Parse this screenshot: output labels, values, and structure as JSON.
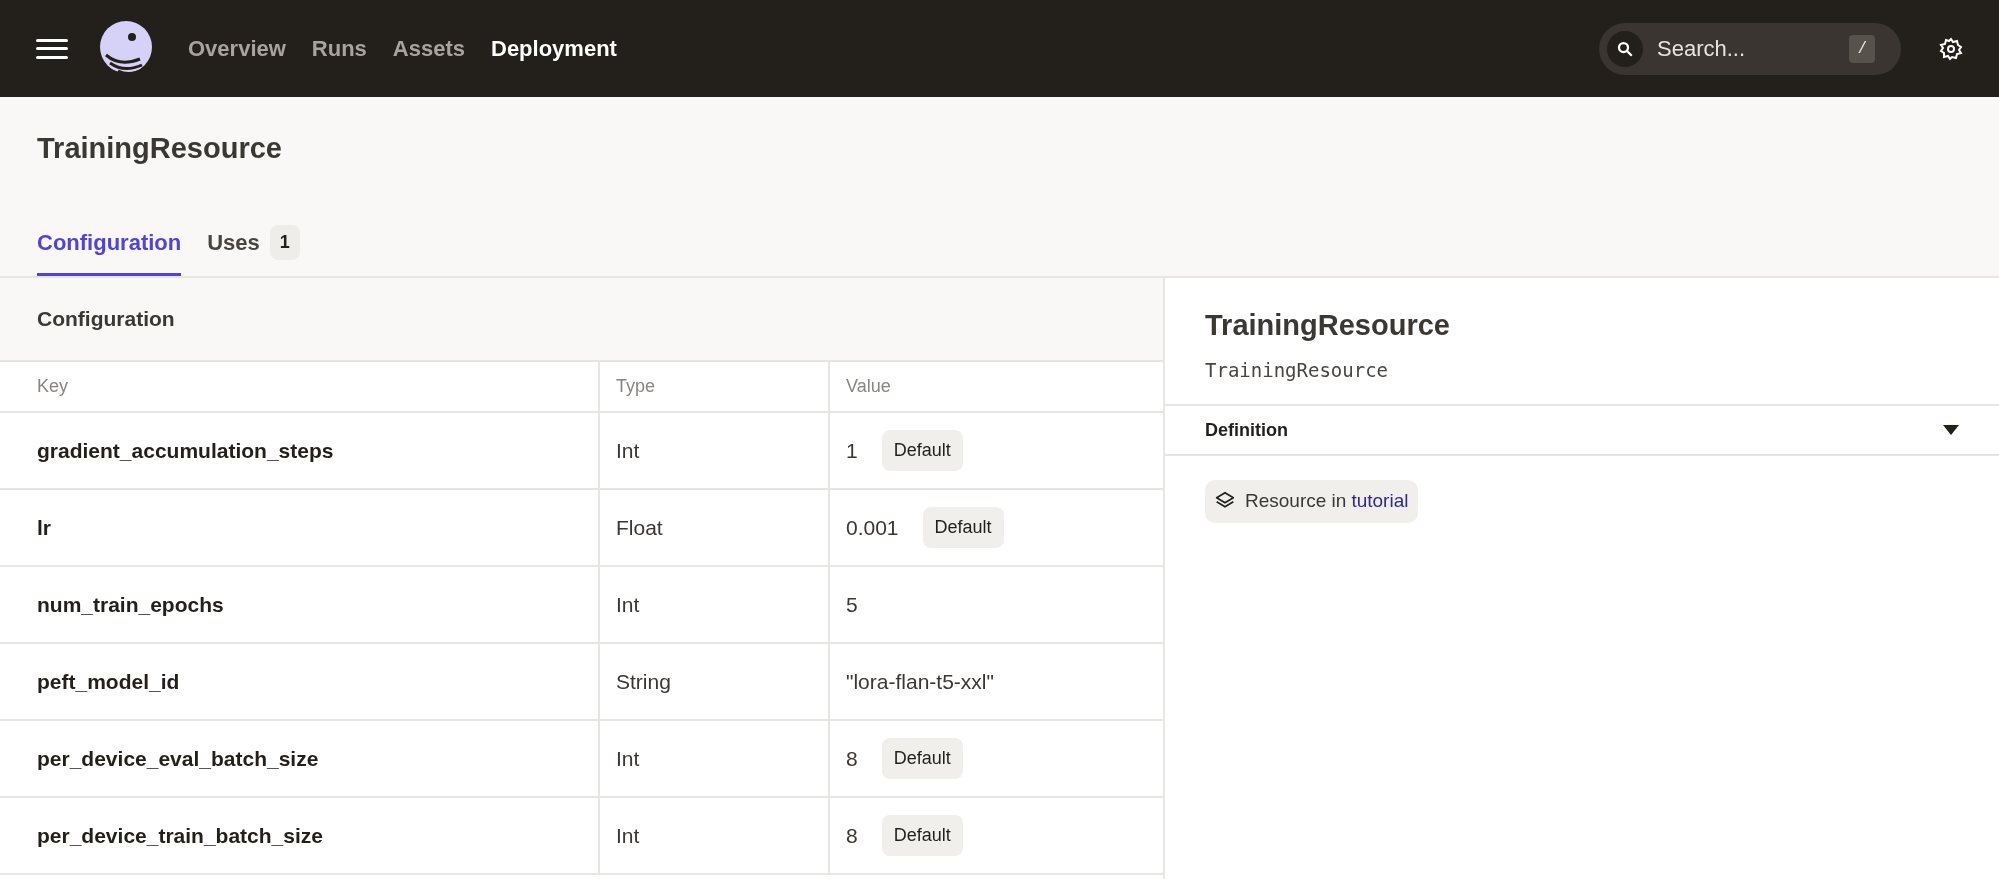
{
  "nav": {
    "links": [
      {
        "label": "Overview",
        "selected": false
      },
      {
        "label": "Runs",
        "selected": false
      },
      {
        "label": "Assets",
        "selected": false
      },
      {
        "label": "Deployment",
        "selected": true
      }
    ],
    "search": {
      "placeholder": "Search...",
      "shortcut": "/"
    }
  },
  "page": {
    "title": "TrainingResource",
    "tabs": [
      {
        "label": "Configuration",
        "selected": true
      },
      {
        "label": "Uses",
        "count": "1",
        "selected": false
      }
    ]
  },
  "config": {
    "title": "Configuration",
    "columns": [
      "Key",
      "Type",
      "Value"
    ],
    "rows": [
      {
        "key": "gradient_accumulation_steps",
        "type": "Int",
        "value": "1",
        "tag": "Default"
      },
      {
        "key": "lr",
        "type": "Float",
        "value": "0.001",
        "tag": "Default"
      },
      {
        "key": "num_train_epochs",
        "type": "Int",
        "value": "5"
      },
      {
        "key": "peft_model_id",
        "type": "String",
        "value": "\"lora-flan-t5-xxl\""
      },
      {
        "key": "per_device_eval_batch_size",
        "type": "Int",
        "value": "8",
        "tag": "Default"
      },
      {
        "key": "per_device_train_batch_size",
        "type": "Int",
        "value": "8",
        "tag": "Default"
      }
    ]
  },
  "details": {
    "title": "TrainingResource",
    "subtitle": "TrainingResource",
    "section": {
      "title": "Definition",
      "expanded": true
    },
    "badge": {
      "text": "Resource in",
      "link": "tutorial"
    }
  }
}
